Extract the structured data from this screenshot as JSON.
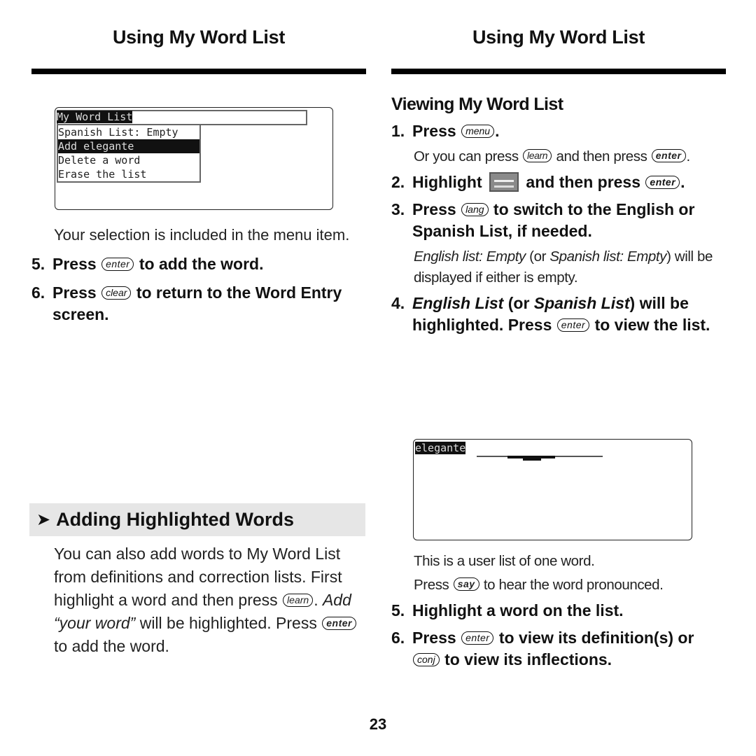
{
  "left": {
    "header": "Using My Word List",
    "screen": {
      "title": "My Word List",
      "items": [
        {
          "label": "Spanish List: Empty",
          "selected": false
        },
        {
          "label": "Add elegante",
          "selected": true
        },
        {
          "label": "Delete a word",
          "selected": false
        },
        {
          "label": "Erase the list",
          "selected": false
        }
      ]
    },
    "note": "Your selection is included in the menu item.",
    "steps": [
      {
        "num": "5.",
        "pre": "Press",
        "key": "enter",
        "post": "to add the word."
      },
      {
        "num": "6.",
        "pre": "Press",
        "key": "clear",
        "post": "to return to the Word Entry screen."
      }
    ],
    "section": {
      "arrow_icon": "arrowhead-right",
      "title": "Adding Highlighted Words",
      "body_1": "You can also add words to My Word List from definitions and correction lists. First highlight a word and then press",
      "key_1": "learn",
      "body_2_italic": "Add “your word”",
      "body_3": "will be highlighted. Press",
      "key_2": "enter",
      "body_4": "to add the word."
    }
  },
  "right": {
    "header": "Using My Word List",
    "subhead": "Viewing My Word List",
    "step1": {
      "num": "1.",
      "pre": "Press",
      "key": "menu",
      "post": "."
    },
    "step1_note": {
      "pre": "Or you can press",
      "key1": "learn",
      "mid": "and then press",
      "key2": "enter",
      "post": "."
    },
    "step2": {
      "num": "2.",
      "pre": "Highlight",
      "icon": "word-list-icon",
      "mid": "and then press",
      "key": "enter",
      "post": "."
    },
    "step3": {
      "num": "3.",
      "pre": "Press",
      "key": "lang",
      "post": "to switch to the English or Spanish List, if needed."
    },
    "step3_note": {
      "italic1": "English list: Empty",
      "mid": "(or",
      "italic2": "Spanish list: Empty",
      "post": ") will be displayed if either is empty."
    },
    "step4": {
      "num": "4.",
      "italic1": "English List",
      "mid1": "(or",
      "italic2": "Spanish List",
      "mid2": ") will be highlighted. Press",
      "key": "enter",
      "post": "to view the list."
    },
    "screen": {
      "word": "elegante"
    },
    "note1": "This is a user list of one word.",
    "note2": {
      "pre": "Press",
      "key": "say",
      "post": "to hear the word pronounced."
    },
    "step5": {
      "num": "5.",
      "text": "Highlight a word on the list."
    },
    "step6": {
      "num": "6.",
      "pre": "Press",
      "key1": "enter",
      "mid": "to view its definition(s) or",
      "key2": "conj",
      "post": "to view its inflections."
    }
  },
  "page_number": "23"
}
